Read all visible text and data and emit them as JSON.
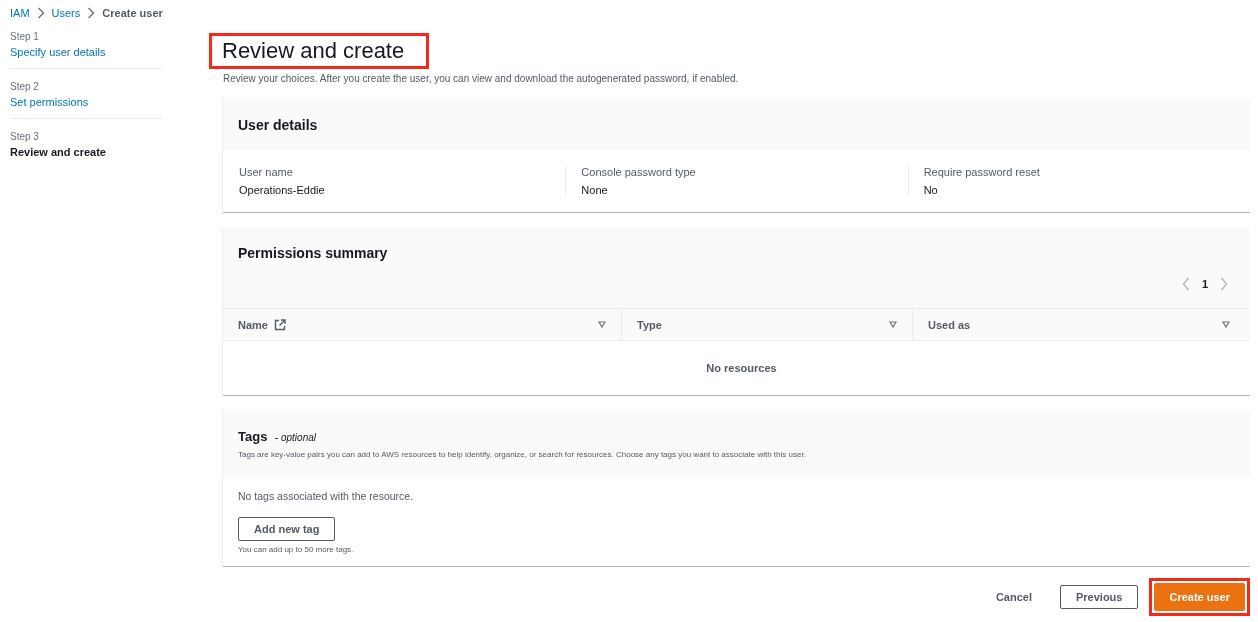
{
  "breadcrumb": [
    {
      "label": "IAM",
      "kind": "link"
    },
    {
      "label": "Users",
      "kind": "link"
    },
    {
      "label": "Create user",
      "kind": "current"
    }
  ],
  "steps": [
    {
      "step": "Step 1",
      "label": "Specify user details",
      "selected": false
    },
    {
      "step": "Step 2",
      "label": "Set permissions",
      "selected": false
    },
    {
      "step": "Step 3",
      "label": "Review and create",
      "selected": true
    }
  ],
  "title": {
    "text": "Review and create",
    "highlighted": true
  },
  "description": "Review your choices. After you create the user, you can view and download the autogenerated password, if enabled.",
  "user_details": {
    "title": "User details",
    "fields": [
      {
        "label": "User name",
        "value": "Operations-Eddie"
      },
      {
        "label": "Console password type",
        "value": "None"
      },
      {
        "label": "Require password reset",
        "value": "No"
      }
    ]
  },
  "permissions_summary": {
    "title": "Permissions summary",
    "pagination": {
      "page": "1"
    },
    "columns": [
      {
        "label": "Name",
        "external_link": true
      },
      {
        "label": "Type",
        "external_link": false
      },
      {
        "label": "Used as",
        "external_link": false
      }
    ],
    "empty_text": "No resources"
  },
  "tags": {
    "title": "Tags",
    "optional": "- optional",
    "description": "Tags are key-value pairs you can add to AWS resources to help identify, organize, or search for resources. Choose any tags you want to associate with this user.",
    "empty_text": "No tags associated with the resource.",
    "add_button": "Add new tag",
    "hint": "You can add up to 50 more tags."
  },
  "footer": [
    {
      "label": "Cancel",
      "kind": "link",
      "highlighted": false
    },
    {
      "label": "Previous",
      "kind": "normal",
      "highlighted": false
    },
    {
      "label": "Create user",
      "kind": "primary",
      "highlighted": true
    }
  ]
}
